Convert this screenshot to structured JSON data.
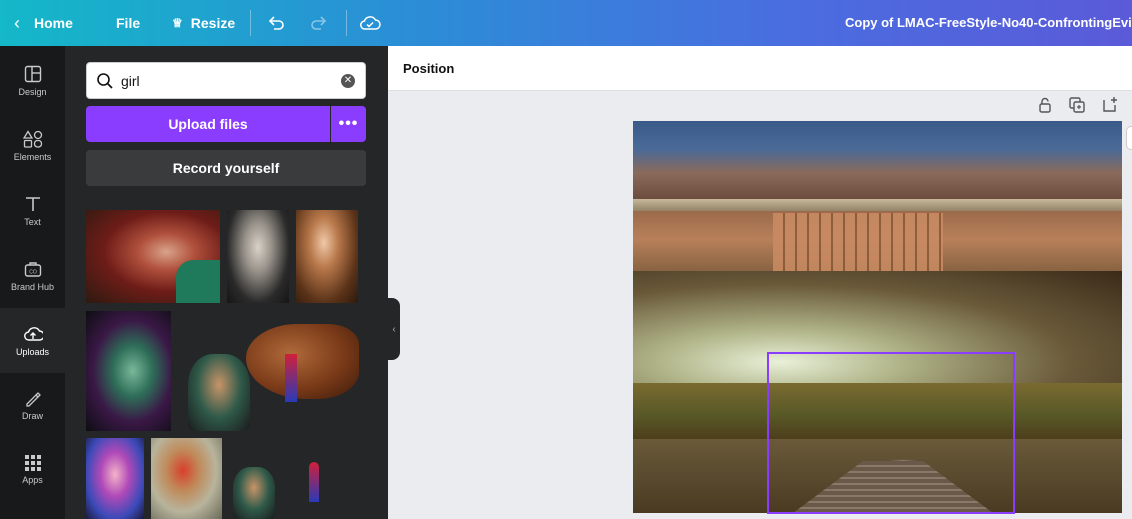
{
  "topbar": {
    "home_label": "Home",
    "file_label": "File",
    "resize_label": "Resize",
    "document_title": "Copy of LMAC-FreeStyle-No40-ConfrontingEvi"
  },
  "rail": {
    "items": [
      {
        "label": "Design",
        "icon": "design-icon"
      },
      {
        "label": "Elements",
        "icon": "elements-icon"
      },
      {
        "label": "Text",
        "icon": "text-icon"
      },
      {
        "label": "Brand Hub",
        "icon": "brand-hub-icon"
      },
      {
        "label": "Uploads",
        "icon": "uploads-icon",
        "active": true
      },
      {
        "label": "Draw",
        "icon": "draw-icon"
      },
      {
        "label": "Apps",
        "icon": "apps-icon"
      }
    ]
  },
  "panel": {
    "search_value": "girl",
    "upload_label": "Upload files",
    "more_label": "•••",
    "record_label": "Record yourself"
  },
  "editor": {
    "position_label": "Position"
  },
  "colors": {
    "accent": "#8b3dff",
    "rail_bg": "#18191b",
    "panel_bg": "#252627",
    "editor_bg": "#ebecf0"
  }
}
